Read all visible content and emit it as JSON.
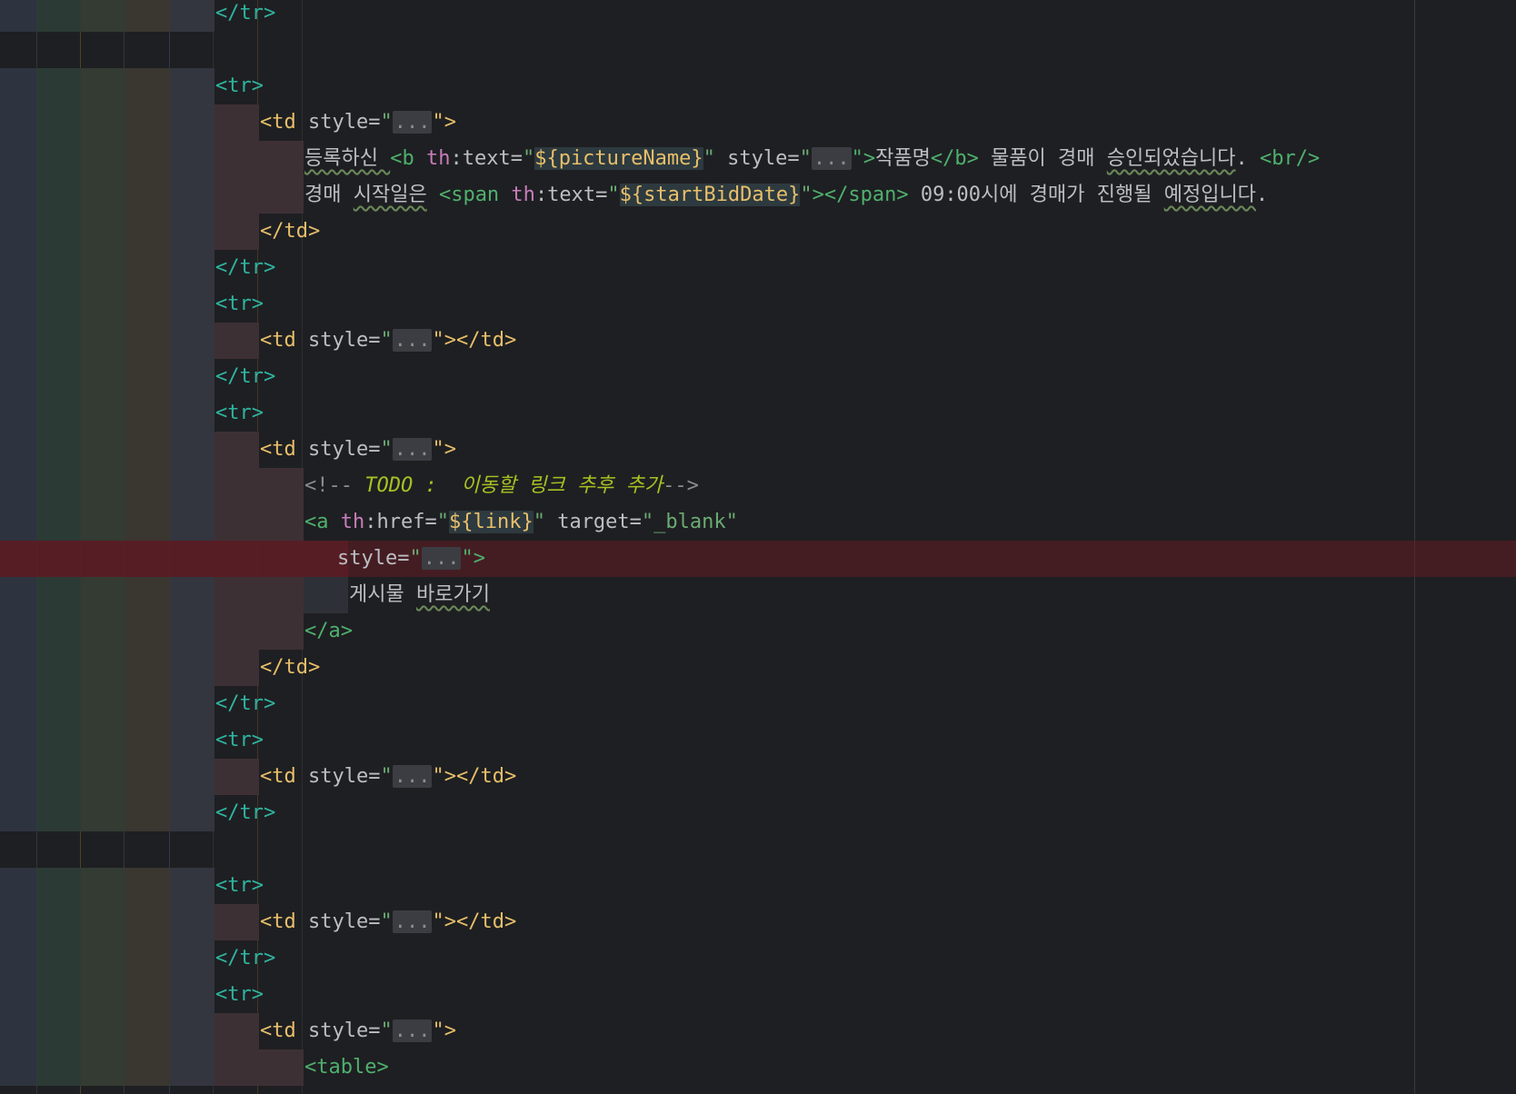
{
  "editor": {
    "file_language": "HTML (Thymeleaf template)",
    "lines": [
      {
        "indent": 5,
        "tokens": [
          {
            "t": "</tr>",
            "c": "tr"
          }
        ]
      },
      {
        "indent": 0,
        "tokens": []
      },
      {
        "indent": 5,
        "tokens": [
          {
            "t": "<tr>",
            "c": "tr"
          }
        ]
      },
      {
        "indent": 6,
        "tokens": [
          {
            "t": "<td",
            "c": "td"
          },
          {
            "t": " style=",
            "c": "attr"
          },
          {
            "t": "\"",
            "c": "str"
          },
          {
            "t": "...",
            "c": "fold"
          },
          {
            "t": "\">",
            "c": "td"
          }
        ]
      },
      {
        "indent": 7,
        "tokens": [
          {
            "t": "등록하신 ",
            "c": "txt",
            "w": 1
          },
          {
            "t": "<b",
            "c": "g"
          },
          {
            "t": " th",
            "c": "ns"
          },
          {
            "t": ":text=",
            "c": "attr"
          },
          {
            "t": "\"",
            "c": "str"
          },
          {
            "t": "${pictureName}",
            "c": "expr"
          },
          {
            "t": "\"",
            "c": "str"
          },
          {
            "t": " style=",
            "c": "attr"
          },
          {
            "t": "\"",
            "c": "str"
          },
          {
            "t": "...",
            "c": "fold"
          },
          {
            "t": "\">",
            "c": "g"
          },
          {
            "t": "작품명",
            "c": "txt"
          },
          {
            "t": "</b>",
            "c": "g"
          },
          {
            "t": " 물품이 경매 ",
            "c": "txt"
          },
          {
            "t": "승인되었습니다",
            "c": "txt",
            "w": 1
          },
          {
            "t": ". ",
            "c": "txt"
          },
          {
            "t": "<br/>",
            "c": "g"
          }
        ]
      },
      {
        "indent": 7,
        "tokens": [
          {
            "t": "경매 ",
            "c": "txt"
          },
          {
            "t": "시작일은",
            "c": "txt",
            "w": 1
          },
          {
            "t": " ",
            "c": "txt"
          },
          {
            "t": "<span",
            "c": "g"
          },
          {
            "t": " th",
            "c": "ns"
          },
          {
            "t": ":text=",
            "c": "attr"
          },
          {
            "t": "\"",
            "c": "str"
          },
          {
            "t": "${startBidDate}",
            "c": "expr"
          },
          {
            "t": "\"",
            "c": "str"
          },
          {
            "t": "></span>",
            "c": "g"
          },
          {
            "t": " 09:00시에 경매가 진행될 ",
            "c": "txt"
          },
          {
            "t": "예정입니다",
            "c": "txt",
            "w": 1
          },
          {
            "t": ".",
            "c": "txt"
          }
        ]
      },
      {
        "indent": 6,
        "tokens": [
          {
            "t": "</td>",
            "c": "td"
          }
        ]
      },
      {
        "indent": 5,
        "tokens": [
          {
            "t": "</tr>",
            "c": "tr"
          }
        ]
      },
      {
        "indent": 5,
        "tokens": [
          {
            "t": "<tr>",
            "c": "tr"
          }
        ]
      },
      {
        "indent": 6,
        "tokens": [
          {
            "t": "<td",
            "c": "td"
          },
          {
            "t": " style=",
            "c": "attr"
          },
          {
            "t": "\"",
            "c": "str"
          },
          {
            "t": "...",
            "c": "fold"
          },
          {
            "t": "\"></td>",
            "c": "td"
          }
        ]
      },
      {
        "indent": 5,
        "tokens": [
          {
            "t": "</tr>",
            "c": "tr"
          }
        ]
      },
      {
        "indent": 5,
        "tokens": [
          {
            "t": "<tr>",
            "c": "tr"
          }
        ]
      },
      {
        "indent": 6,
        "tokens": [
          {
            "t": "<td",
            "c": "td"
          },
          {
            "t": " style=",
            "c": "attr"
          },
          {
            "t": "\"",
            "c": "str"
          },
          {
            "t": "...",
            "c": "fold"
          },
          {
            "t": "\">",
            "c": "td"
          }
        ]
      },
      {
        "indent": 7,
        "tokens": [
          {
            "t": "<!-- ",
            "c": "comment"
          },
          {
            "t": "TODO :  이동할 링크 추후 추가",
            "c": "todo"
          },
          {
            "t": "-->",
            "c": "comment"
          }
        ]
      },
      {
        "indent": 7,
        "tokens": [
          {
            "t": "<a",
            "c": "g"
          },
          {
            "t": " th",
            "c": "ns"
          },
          {
            "t": ":href=",
            "c": "attr"
          },
          {
            "t": "\"",
            "c": "str"
          },
          {
            "t": "${link}",
            "c": "expr"
          },
          {
            "t": "\"",
            "c": "str"
          },
          {
            "t": " target=",
            "c": "attr"
          },
          {
            "t": "\"_blank\"",
            "c": "str"
          }
        ]
      },
      {
        "indent": 8,
        "error": true,
        "tokens": [
          {
            "t": "style=",
            "c": "attr"
          },
          {
            "t": "\"",
            "c": "str"
          },
          {
            "t": "...",
            "c": "fold"
          },
          {
            "t": "\">",
            "c": "g"
          }
        ]
      },
      {
        "indent": 8,
        "tokens": [
          {
            "t": "게시물 ",
            "c": "txt"
          },
          {
            "t": "바로가기",
            "c": "txt",
            "w": 1
          }
        ]
      },
      {
        "indent": 7,
        "tokens": [
          {
            "t": "</a>",
            "c": "g"
          }
        ]
      },
      {
        "indent": 6,
        "tokens": [
          {
            "t": "</td>",
            "c": "td"
          }
        ]
      },
      {
        "indent": 5,
        "tokens": [
          {
            "t": "</tr>",
            "c": "tr"
          }
        ]
      },
      {
        "indent": 5,
        "tokens": [
          {
            "t": "<tr>",
            "c": "tr"
          }
        ]
      },
      {
        "indent": 6,
        "tokens": [
          {
            "t": "<td",
            "c": "td"
          },
          {
            "t": " style=",
            "c": "attr"
          },
          {
            "t": "\"",
            "c": "str"
          },
          {
            "t": "...",
            "c": "fold"
          },
          {
            "t": "\"></td>",
            "c": "td"
          }
        ]
      },
      {
        "indent": 5,
        "tokens": [
          {
            "t": "</tr>",
            "c": "tr"
          }
        ]
      },
      {
        "indent": 0,
        "tokens": []
      },
      {
        "indent": 5,
        "tokens": [
          {
            "t": "<tr>",
            "c": "tr"
          }
        ]
      },
      {
        "indent": 6,
        "tokens": [
          {
            "t": "<td",
            "c": "td"
          },
          {
            "t": " style=",
            "c": "attr"
          },
          {
            "t": "\"",
            "c": "str"
          },
          {
            "t": "...",
            "c": "fold"
          },
          {
            "t": "\"></td>",
            "c": "td"
          }
        ]
      },
      {
        "indent": 5,
        "tokens": [
          {
            "t": "</tr>",
            "c": "tr"
          }
        ]
      },
      {
        "indent": 5,
        "tokens": [
          {
            "t": "<tr>",
            "c": "tr"
          }
        ]
      },
      {
        "indent": 6,
        "tokens": [
          {
            "t": "<td",
            "c": "td"
          },
          {
            "t": " style=",
            "c": "attr"
          },
          {
            "t": "\"",
            "c": "str"
          },
          {
            "t": "...",
            "c": "fold"
          },
          {
            "t": "\">",
            "c": "td"
          }
        ]
      },
      {
        "indent": 7,
        "tokens": [
          {
            "t": "<table>",
            "c": "g"
          }
        ]
      }
    ]
  },
  "colors": {
    "background": "#1e1f22",
    "indent_rainbow": [
      "#2e3340",
      "#2c3a35",
      "#333b33",
      "#3a3630",
      "#33353f",
      "#3d3034",
      "#3d3034",
      "#2d3036",
      "#2f3337"
    ],
    "error_line": "#4a2027"
  }
}
